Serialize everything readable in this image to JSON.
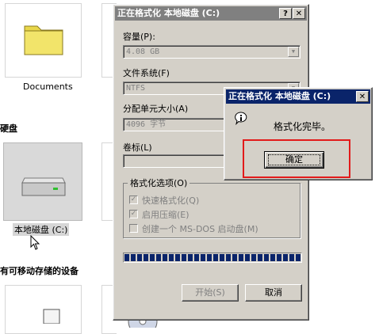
{
  "explorer": {
    "documents_label": "Documents",
    "hard_disks_header": "硬盘",
    "local_disk_label": "本地磁盘 (C:)",
    "removable_header": "有可移动存储的设备"
  },
  "format_dialog": {
    "title": "正在格式化 本地磁盘 (C:)",
    "help_btn": "?",
    "close_btn": "✕",
    "capacity_label": "容量(P):",
    "capacity_value": "4.08 GB",
    "filesystem_label": "文件系统(F)",
    "filesystem_value": "NTFS",
    "alloc_label": "分配单元大小(A)",
    "alloc_value": "4096 字节",
    "volume_label": "卷标(L)",
    "volume_value": "",
    "options_label": "格式化选项(O)",
    "opt_quick": "快速格式化(Q)",
    "opt_compress": "启用压缩(E)",
    "opt_msdos": "创建一个 MS-DOS 启动盘(M)",
    "start_btn": "开始(S)",
    "cancel_btn": "取消",
    "progress": 1.0
  },
  "message_box": {
    "title": "正在格式化 本地磁盘 (C:)",
    "close_btn": "✕",
    "message": "格式化完毕。",
    "ok_btn": "确定",
    "info_icon": "info-icon"
  },
  "colors": {
    "highlight": "#e21a1a",
    "title_active": "#0a246a",
    "title_inactive": "#808080"
  }
}
